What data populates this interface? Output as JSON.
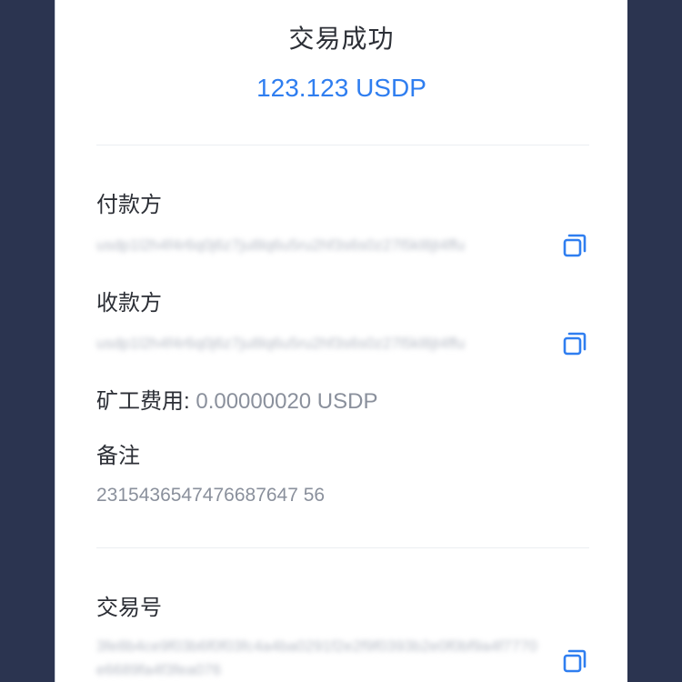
{
  "header": {
    "title": "交易成功",
    "amount": "123.123 USDP"
  },
  "payer": {
    "label": "付款方",
    "address": "usdp1l2h4f4r6q0j6z7ju8lq6u5ru2hf3s6s0z27l5kl8jt4ffu",
    "copy_icon": "copy-icon"
  },
  "payee": {
    "label": "收款方",
    "address": "usdp1l2h4f4r6q0j6z7ju8lq6u5ru2hf3s6s0z27l5kl8jt4ffu",
    "copy_icon": "copy-icon"
  },
  "fee": {
    "label": "矿工费用:",
    "value": "0.00000020 USDP"
  },
  "memo": {
    "label": "备注",
    "value": "2315436547476687647 56"
  },
  "tx": {
    "label": "交易号",
    "hash": "3fe8b4ce9f03b6f0f03fc4a4ba0291f2e2f9f0393b2e0f0bf9a4f7770e6689fa4f3fea076",
    "copy_icon": "copy-icon"
  },
  "colors": {
    "accent": "#2f7ef0",
    "background": "#2b3450",
    "text": "#2c2f36",
    "muted": "#8a909c"
  }
}
